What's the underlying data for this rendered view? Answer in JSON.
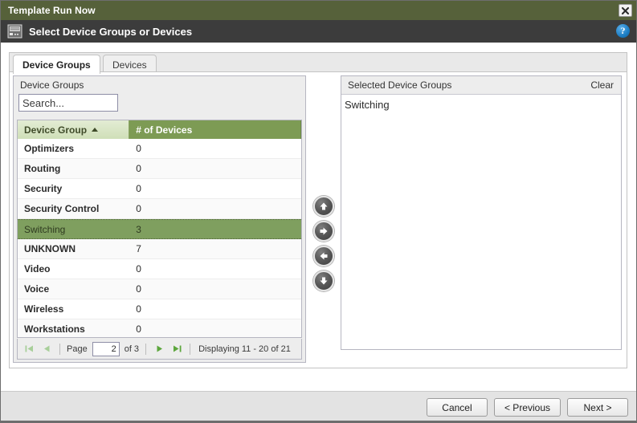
{
  "window": {
    "title": "Template Run Now",
    "close_icon": "close-icon",
    "subtitle": "Select Device Groups or Devices",
    "device_icon": "device-chassis-icon",
    "help_label": "?",
    "help_icon": "help-icon"
  },
  "tabs": [
    {
      "label": "Device Groups",
      "active": true
    },
    {
      "label": "Devices",
      "active": false
    }
  ],
  "left_panel": {
    "title": "Device Groups",
    "search": {
      "value": "",
      "placeholder": "Search..."
    },
    "columns": [
      {
        "label": "Device Group",
        "sorted": true,
        "sort_direction": "asc"
      },
      {
        "label": "# of Devices",
        "sorted": false
      }
    ],
    "rows": [
      {
        "group": "Optimizers",
        "devices": "0",
        "selected": false
      },
      {
        "group": "Routing",
        "devices": "0",
        "selected": false
      },
      {
        "group": "Security",
        "devices": "0",
        "selected": false
      },
      {
        "group": "Security Control",
        "devices": "0",
        "selected": false
      },
      {
        "group": "Switching",
        "devices": "3",
        "selected": true
      },
      {
        "group": "UNKNOWN",
        "devices": "7",
        "selected": false
      },
      {
        "group": "Video",
        "devices": "0",
        "selected": false
      },
      {
        "group": "Voice",
        "devices": "0",
        "selected": false
      },
      {
        "group": "Wireless",
        "devices": "0",
        "selected": false
      },
      {
        "group": "Workstations",
        "devices": "0",
        "selected": false
      }
    ],
    "pager": {
      "first_icon": "first-page-icon",
      "prev_icon": "previous-page-icon",
      "page_label": "Page",
      "page_value": "2",
      "of_label": "of 3",
      "next_icon": "next-page-icon",
      "last_icon": "last-page-icon",
      "display_text": "Displaying 11 - 20 of 21"
    }
  },
  "transfer_buttons": [
    {
      "name": "move-up-button",
      "icon": "arrow-up-icon"
    },
    {
      "name": "add-button",
      "icon": "arrow-right-icon"
    },
    {
      "name": "remove-button",
      "icon": "arrow-left-icon"
    },
    {
      "name": "move-down-button",
      "icon": "arrow-down-icon"
    }
  ],
  "right_panel": {
    "title": "Selected Device Groups",
    "clear_label": "Clear",
    "items": [
      "Switching"
    ]
  },
  "footer": {
    "cancel_label": "Cancel",
    "previous_label": "< Previous",
    "next_label": "Next >"
  },
  "colors": {
    "title_bar": "#56613a",
    "sub_header": "#3c3c3c",
    "grid_header": "#7d9b54",
    "grid_header_sorted": "#cfdfb8",
    "row_selected": "#7f9f5f",
    "pager_active": "#5ca63c",
    "pager_disabled": "#a8cf9a",
    "help_blue": "#1d7ec4"
  }
}
